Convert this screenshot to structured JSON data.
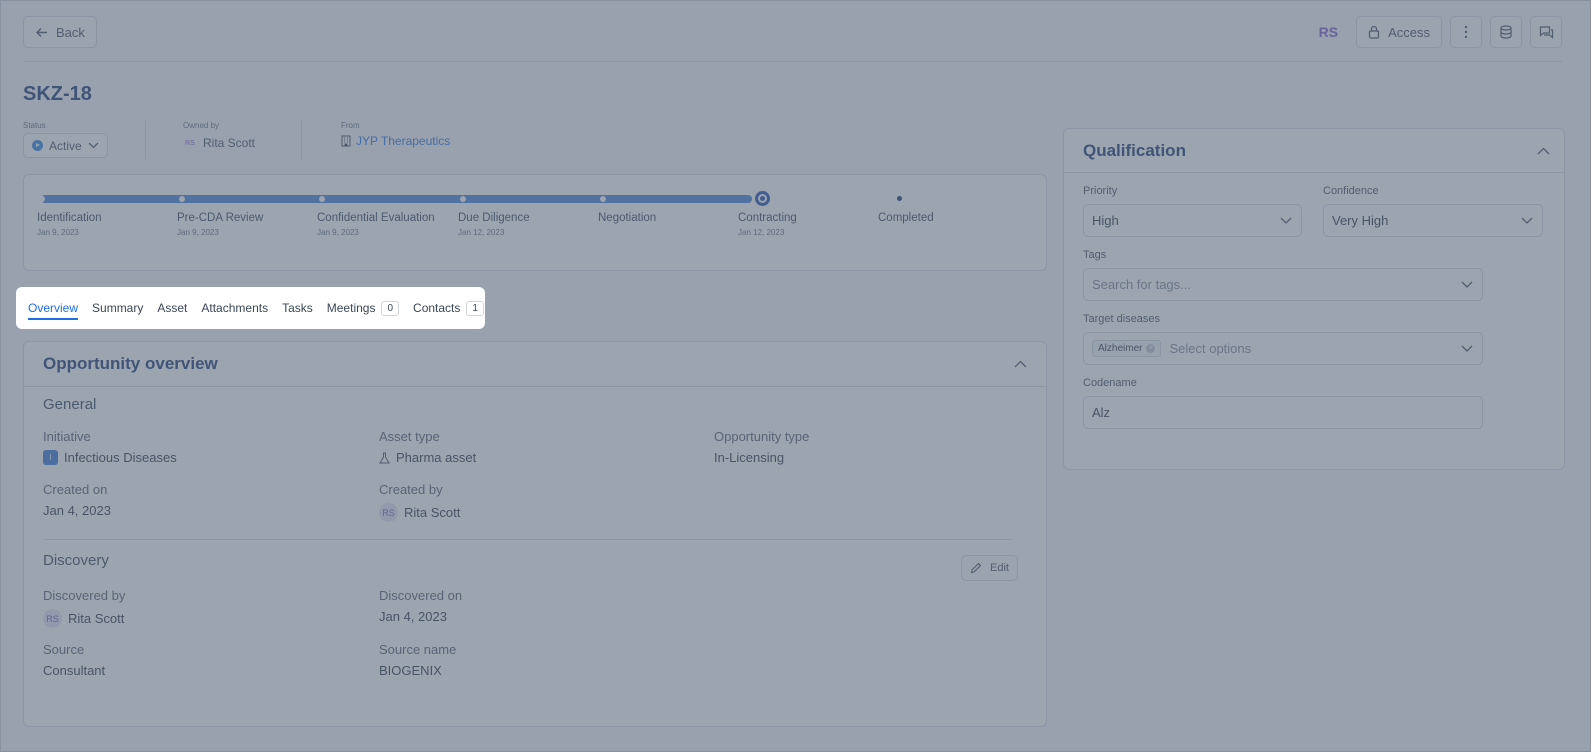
{
  "header": {
    "back_label": "Back",
    "user_initials": "RS",
    "access_label": "Access"
  },
  "page": {
    "title": "SKZ-18"
  },
  "meta": {
    "status_label": "Status",
    "status_value": "Active",
    "owned_by_label": "Owned by",
    "owner_initials": "RS",
    "owner_name": "Rita Scott",
    "from_label": "From",
    "from_value": "JYP Therapeutics"
  },
  "progress": {
    "stages": [
      {
        "name": "Identification",
        "date": "Jan 9, 2023"
      },
      {
        "name": "Pre-CDA Review",
        "date": "Jan 9, 2023"
      },
      {
        "name": "Confidential Evaluation",
        "date": "Jan 9, 2023"
      },
      {
        "name": "Due Diligence",
        "date": "Jan 12, 2023"
      },
      {
        "name": "Negotiation",
        "date": ""
      },
      {
        "name": "Contracting",
        "date": "Jan 12, 2023"
      },
      {
        "name": "Completed",
        "date": ""
      }
    ],
    "current_stage": "Contracting"
  },
  "tabs": [
    {
      "label": "Overview",
      "active": true
    },
    {
      "label": "Summary"
    },
    {
      "label": "Asset"
    },
    {
      "label": "Attachments"
    },
    {
      "label": "Tasks"
    },
    {
      "label": "Meetings",
      "count": "0"
    },
    {
      "label": "Contacts",
      "count": "1"
    }
  ],
  "overview": {
    "title": "Opportunity overview",
    "general": {
      "title": "General",
      "initiative_label": "Initiative",
      "initiative_badge": "I",
      "initiative_value": "Infectious Diseases",
      "asset_type_label": "Asset type",
      "asset_type_value": "Pharma asset",
      "opportunity_type_label": "Opportunity type",
      "opportunity_type_value": "In-Licensing",
      "created_on_label": "Created on",
      "created_on_value": "Jan 4, 2023",
      "created_by_label": "Created by",
      "created_by_initials": "RS",
      "created_by_value": "Rita Scott"
    },
    "discovery": {
      "title": "Discovery",
      "edit_label": "Edit",
      "discovered_by_label": "Discovered by",
      "discovered_by_initials": "RS",
      "discovered_by_value": "Rita Scott",
      "discovered_on_label": "Discovered on",
      "discovered_on_value": "Jan 4, 2023",
      "source_label": "Source",
      "source_value": "Consultant",
      "source_name_label": "Source name",
      "source_name_value": "BIOGENIX"
    }
  },
  "qualification": {
    "title": "Qualification",
    "priority_label": "Priority",
    "priority_value": "High",
    "confidence_label": "Confidence",
    "confidence_value": "Very High",
    "tags_label": "Tags",
    "tags_placeholder": "Search for tags...",
    "target_diseases_label": "Target diseases",
    "target_disease_chip": "Alzheimer",
    "target_diseases_placeholder": "Select options",
    "codename_label": "Codename",
    "codename_value": "Alz"
  }
}
